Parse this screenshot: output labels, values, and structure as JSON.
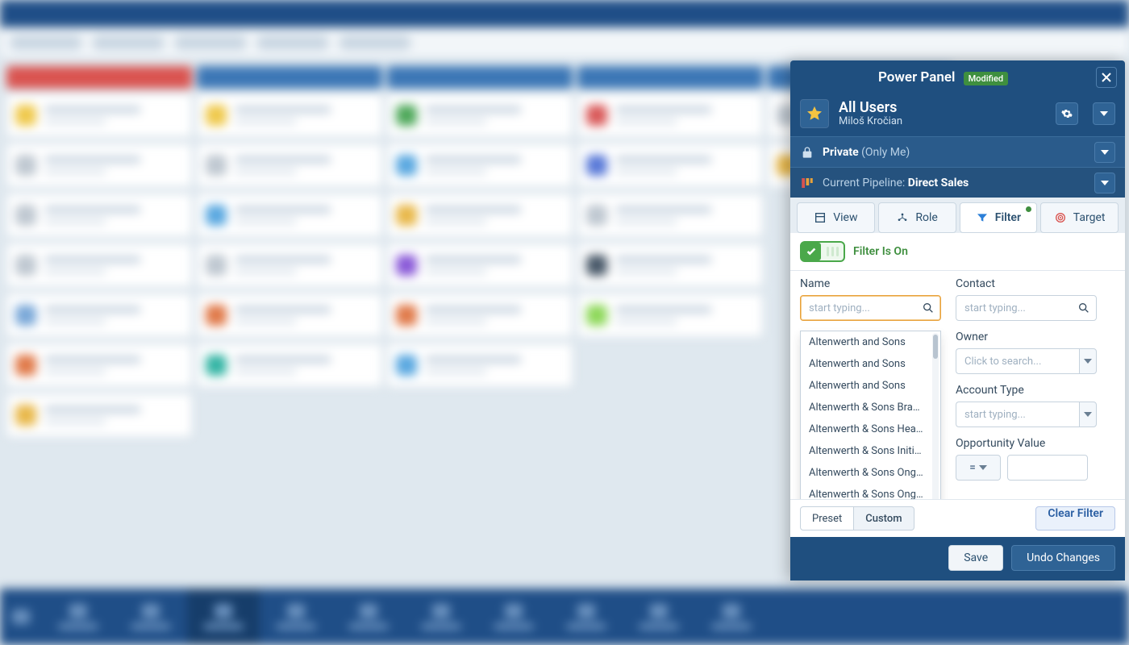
{
  "panel": {
    "title": "Power Panel",
    "modified_badge": "Modified",
    "profile": {
      "title": "All Users",
      "subtitle": "Miloš Kročian"
    },
    "privacy": {
      "label": "Private",
      "suffix": "(Only Me)"
    },
    "pipeline": {
      "label": "Current Pipeline:",
      "value": "Direct Sales"
    },
    "tabs": {
      "view": "View",
      "role": "Role",
      "filter": "Filter",
      "target": "Target"
    },
    "filter_on": "Filter Is On",
    "fields": {
      "name": {
        "label": "Name",
        "placeholder": "start typing..."
      },
      "contact": {
        "label": "Contact",
        "placeholder": "start typing..."
      },
      "owner": {
        "label": "Owner",
        "placeholder": "Click to search..."
      },
      "account_type": {
        "label": "Account Type",
        "placeholder": "start typing..."
      },
      "opp_value": {
        "label": "Opportunity Value",
        "operator": "="
      }
    },
    "name_suggestions": [
      "Altenwerth and Sons",
      "Altenwerth and Sons",
      "Altenwerth and Sons",
      "Altenwerth & Sons Bra…",
      "Altenwerth & Sons Hea…",
      "Altenwerth & Sons Initi…",
      "Altenwerth & Sons Ong…",
      "Altenwerth & Sons Ong…"
    ],
    "footer": {
      "preset": "Preset",
      "custom": "Custom",
      "clear": "Clear Filter",
      "save": "Save",
      "undo": "Undo Changes"
    }
  }
}
